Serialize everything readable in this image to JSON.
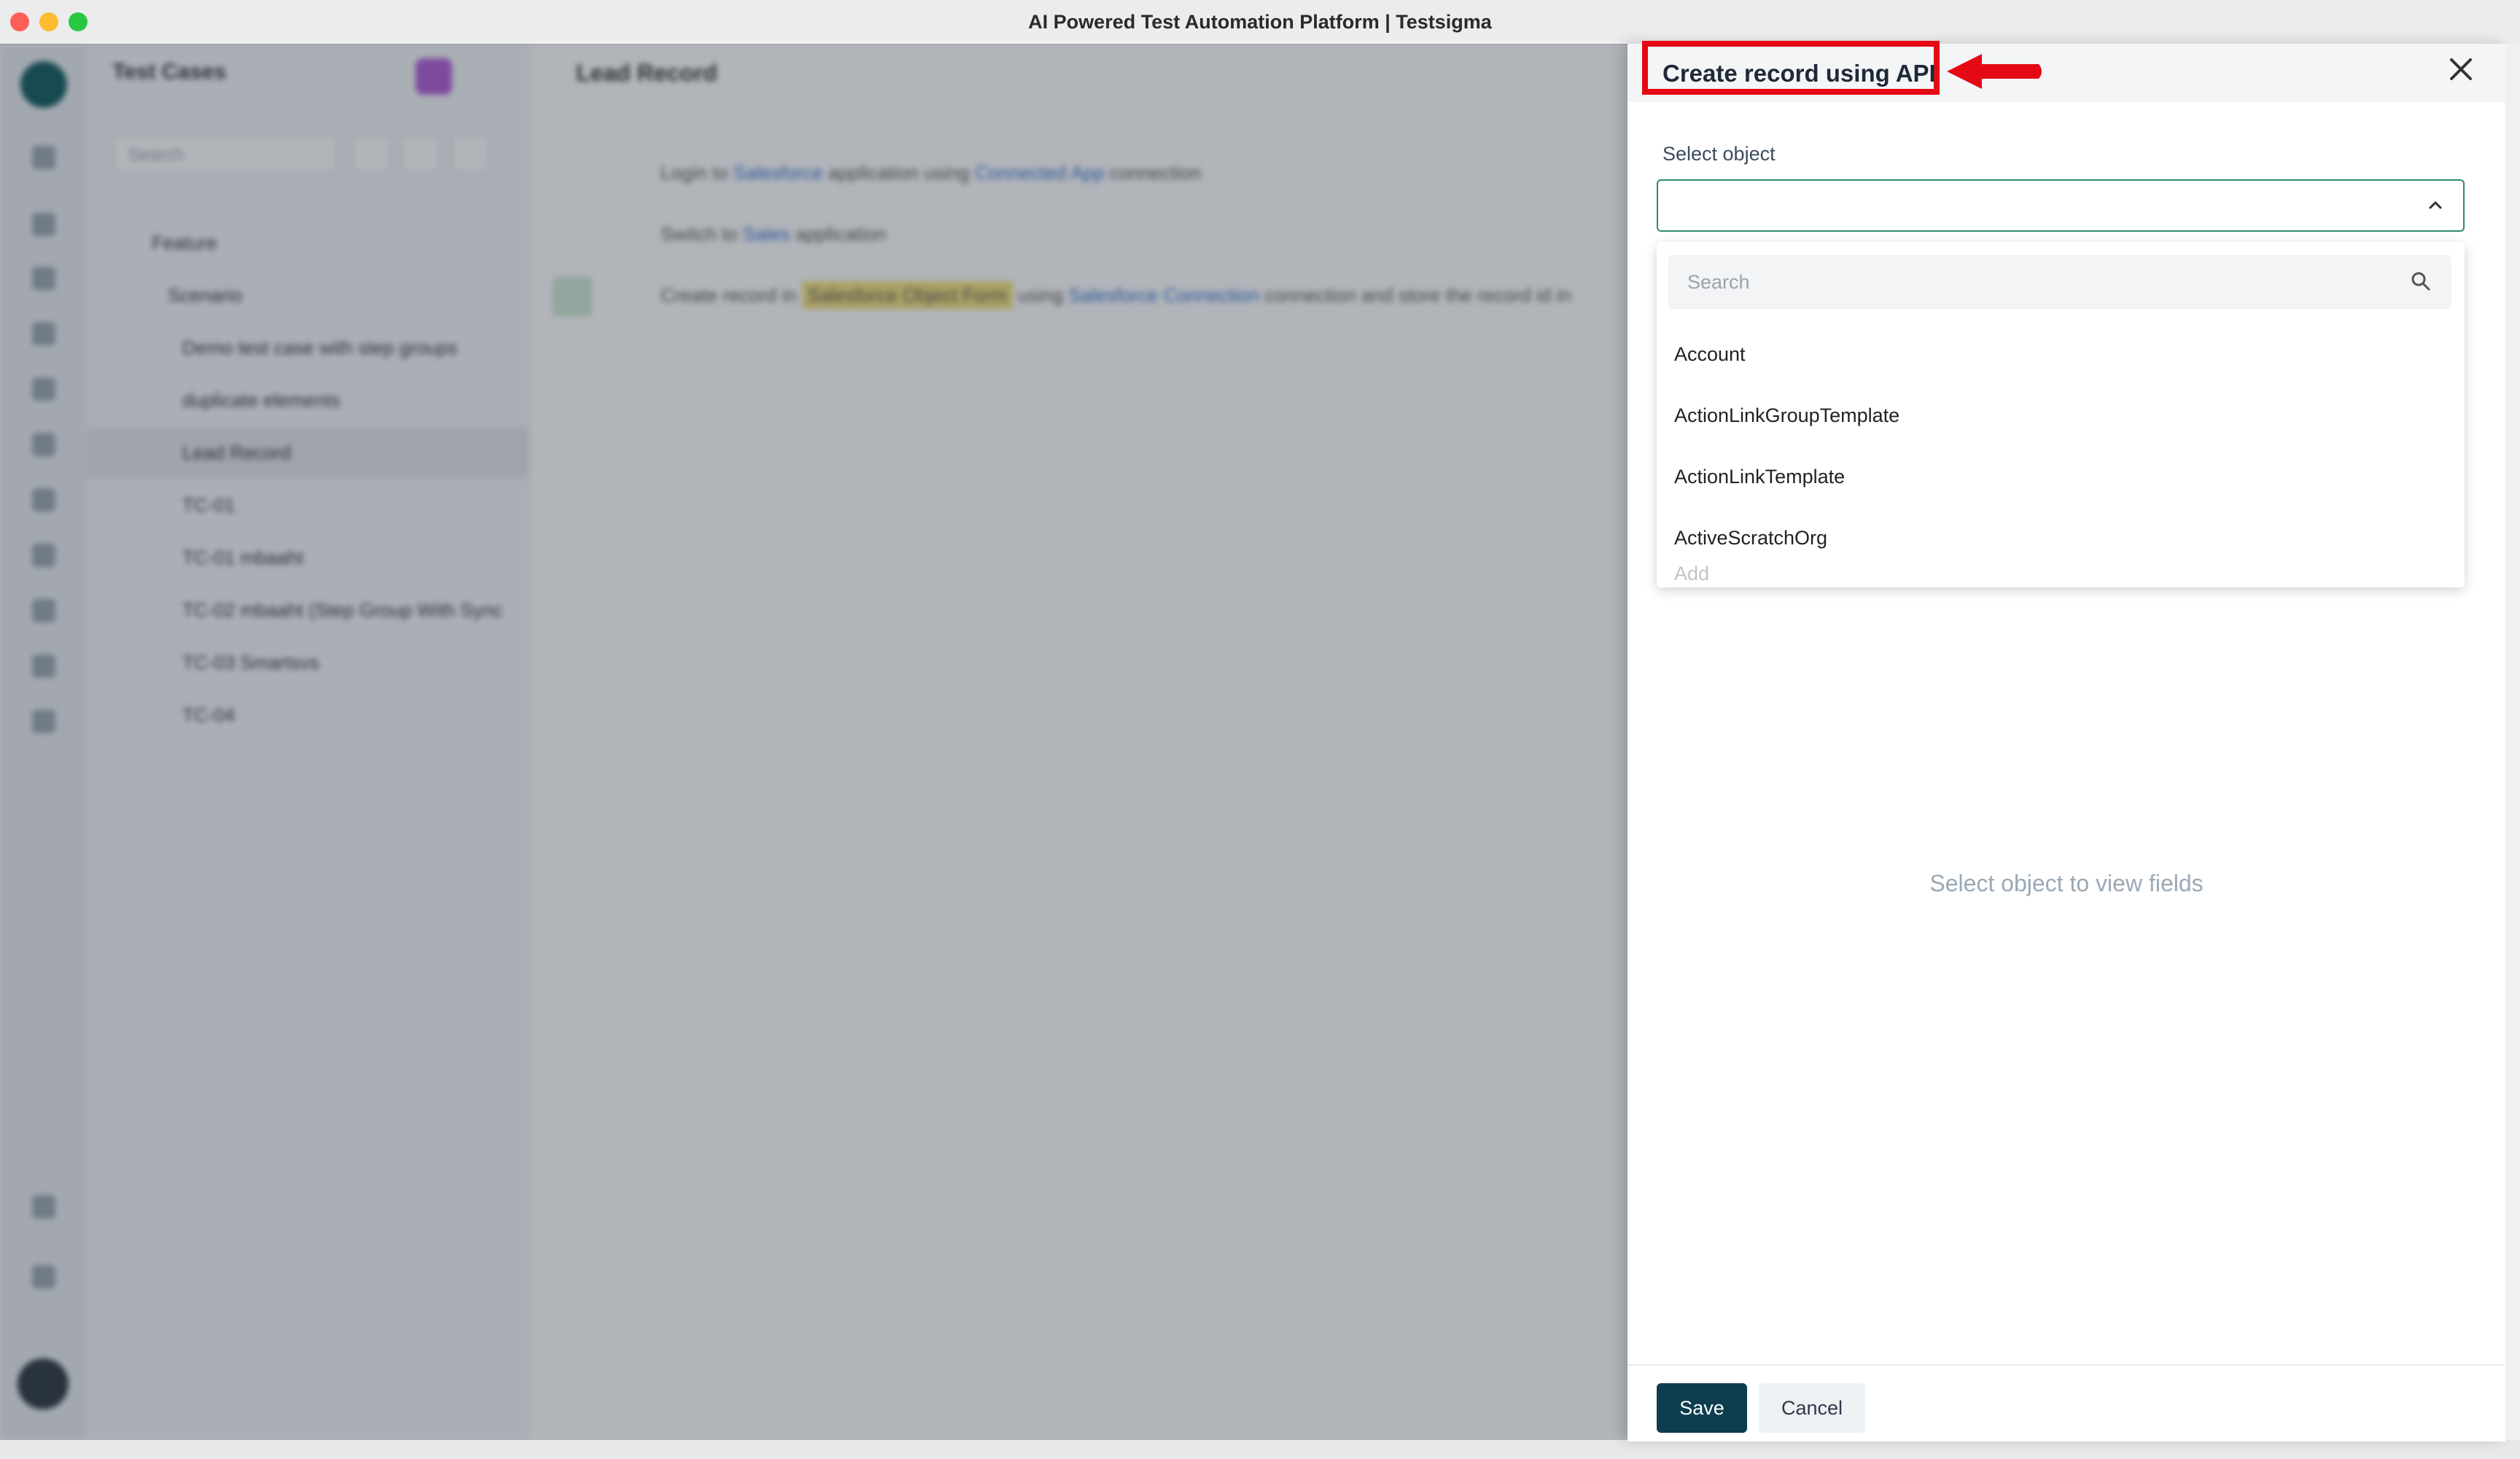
{
  "window": {
    "title": "AI Powered Test Automation Platform | Testsigma"
  },
  "background": {
    "sidebar": {
      "title": "Test Cases",
      "search_placeholder": "Search",
      "tree": [
        "Feature",
        "Scenario",
        "Demo test case with step groups",
        "duplicate elements",
        "Lead Record",
        "TC-01",
        "TC-01 mbaaht",
        "TC-02 mbaaht (Step Group With Sync",
        "TC-03 Smartsvs",
        "TC-04"
      ]
    },
    "main": {
      "title": "Lead Record",
      "steps": [
        {
          "pre": "Login to",
          "link1": "Salesforce",
          "mid": "application using",
          "link2": "Connected App",
          "post": "connection"
        },
        {
          "pre": "Switch to",
          "link1": "Sales",
          "mid": "application",
          "link2": "",
          "post": ""
        },
        {
          "pre": "Create record in",
          "highlight": "Salesforce Object Form",
          "mid": "using",
          "link2": "Salesforce Connection",
          "post": "connection and store the record id in"
        }
      ]
    }
  },
  "drawer": {
    "title": "Create record using API",
    "field_label": "Select object",
    "selected_value": "",
    "dropdown": {
      "search_placeholder": "Search",
      "options": [
        "Account",
        "ActionLinkGroupTemplate",
        "ActionLinkTemplate",
        "ActiveScratchOrg"
      ],
      "partial_option": "Add"
    },
    "empty_message": "Select object to view fields",
    "buttons": {
      "save": "Save",
      "cancel": "Cancel"
    }
  },
  "colors": {
    "annotation": "#e50914",
    "primary_button": "#0c3e4e",
    "select_border": "#2f8a6c"
  },
  "icons": {
    "close": "close-icon",
    "chevron": "chevron-up-icon",
    "search": "search-icon",
    "arrow": "annotation-arrow-icon"
  }
}
